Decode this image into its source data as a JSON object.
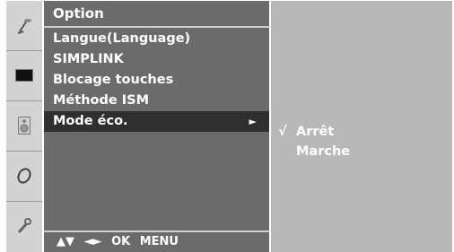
{
  "menu": {
    "title": "Option",
    "items": [
      {
        "label": "Langue(Language)"
      },
      {
        "label": "SIMPLINK"
      },
      {
        "label": "Blocage touches"
      },
      {
        "label": "Méthode ISM"
      },
      {
        "label": "Mode éco."
      }
    ],
    "selected_arrow": "►"
  },
  "footer": {
    "nav_up_down": "▲▼",
    "nav_left_right": "◄►",
    "ok": "OK",
    "menu": "MENU"
  },
  "submenu": {
    "check": "√",
    "options": [
      {
        "label": "Arrêt"
      },
      {
        "label": "Marche"
      }
    ]
  },
  "icons": [
    "antenna-icon",
    "screen-icon",
    "speaker-icon",
    "clock-icon",
    "wrench-icon"
  ],
  "colors": {
    "strip": "#d3d3d3",
    "menu_bg": "#6b6b6b",
    "selected_bg": "#2f2f2f",
    "submenu_bg": "#b8b8b8"
  }
}
